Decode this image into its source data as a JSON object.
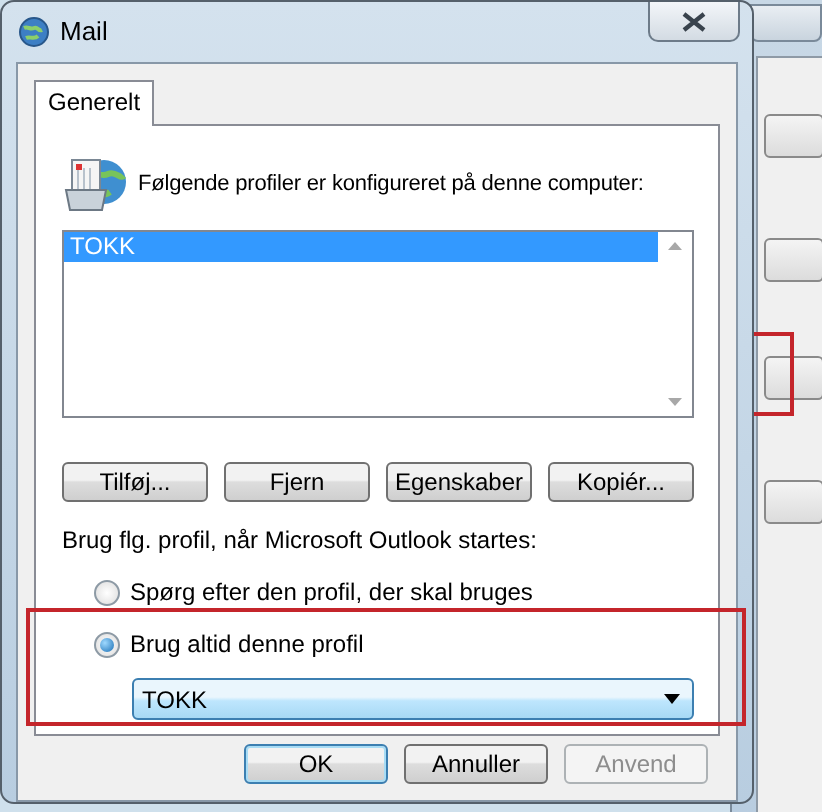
{
  "window": {
    "title": "Mail"
  },
  "tabs": [
    {
      "label": "Generelt",
      "selected": true
    }
  ],
  "intro": "Følgende profiler er konfigureret på denne computer:",
  "profiles": [
    {
      "name": "TOKK",
      "selected": true
    }
  ],
  "profile_buttons": [
    "Tilføj...",
    "Fjern",
    "Egenskaber",
    "Kopiér..."
  ],
  "startup_label": "Brug flg. profil, når Microsoft Outlook startes:",
  "startup_options": [
    {
      "label": "Spørg efter den profil, der skal bruges",
      "selected": false
    },
    {
      "label": "Brug altid denne profil",
      "selected": true
    }
  ],
  "profile_select": {
    "value": "TOKK"
  },
  "buttons": [
    {
      "label": "OK",
      "disabled": false,
      "default": true
    },
    {
      "label": "Annuller",
      "disabled": false,
      "default": false
    },
    {
      "label": "Anvend",
      "disabled": true,
      "default": false
    }
  ]
}
